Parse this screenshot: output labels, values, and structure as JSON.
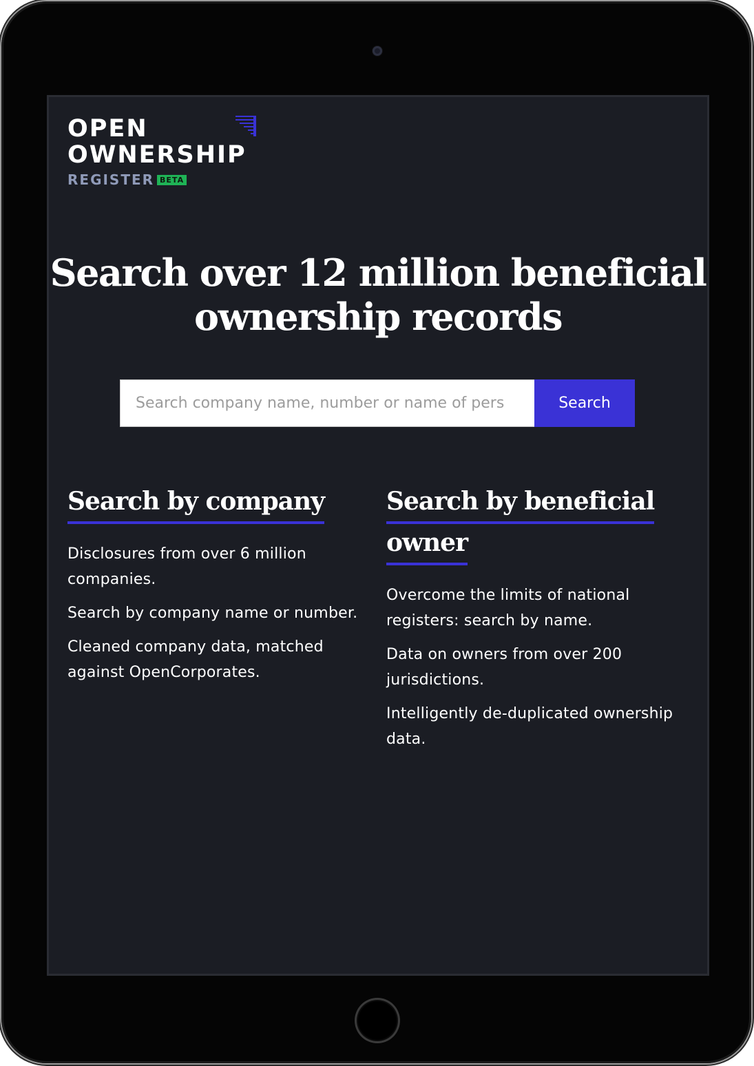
{
  "logo": {
    "line1": "OPEN",
    "line2": "OWNERSHIP",
    "line3": "REGISTER",
    "badge": "BETA",
    "mark_icon": "openownership-stripes-icon",
    "accent_color": "#3a32d6",
    "badge_color": "#1fb356"
  },
  "hero": {
    "title": "Search over 12 million beneficial ownership records"
  },
  "search": {
    "placeholder": "Search company name, number or name of pers",
    "button_label": "Search"
  },
  "columns": [
    {
      "heading": "Search by company",
      "paragraphs": [
        "Disclosures from over 6 million companies.",
        "Search by company name or number.",
        "Cleaned company data, matched against OpenCorporates."
      ]
    },
    {
      "heading": "Search by beneficial owner",
      "paragraphs": [
        "Overcome the limits of national registers: search by name.",
        "Data on owners from over 200 jurisdictions.",
        "Intelligently de-duplicated ownership data."
      ]
    }
  ],
  "colors": {
    "screen_background": "#1b1d24",
    "primary": "#3a32d6",
    "text": "#ffffff"
  }
}
